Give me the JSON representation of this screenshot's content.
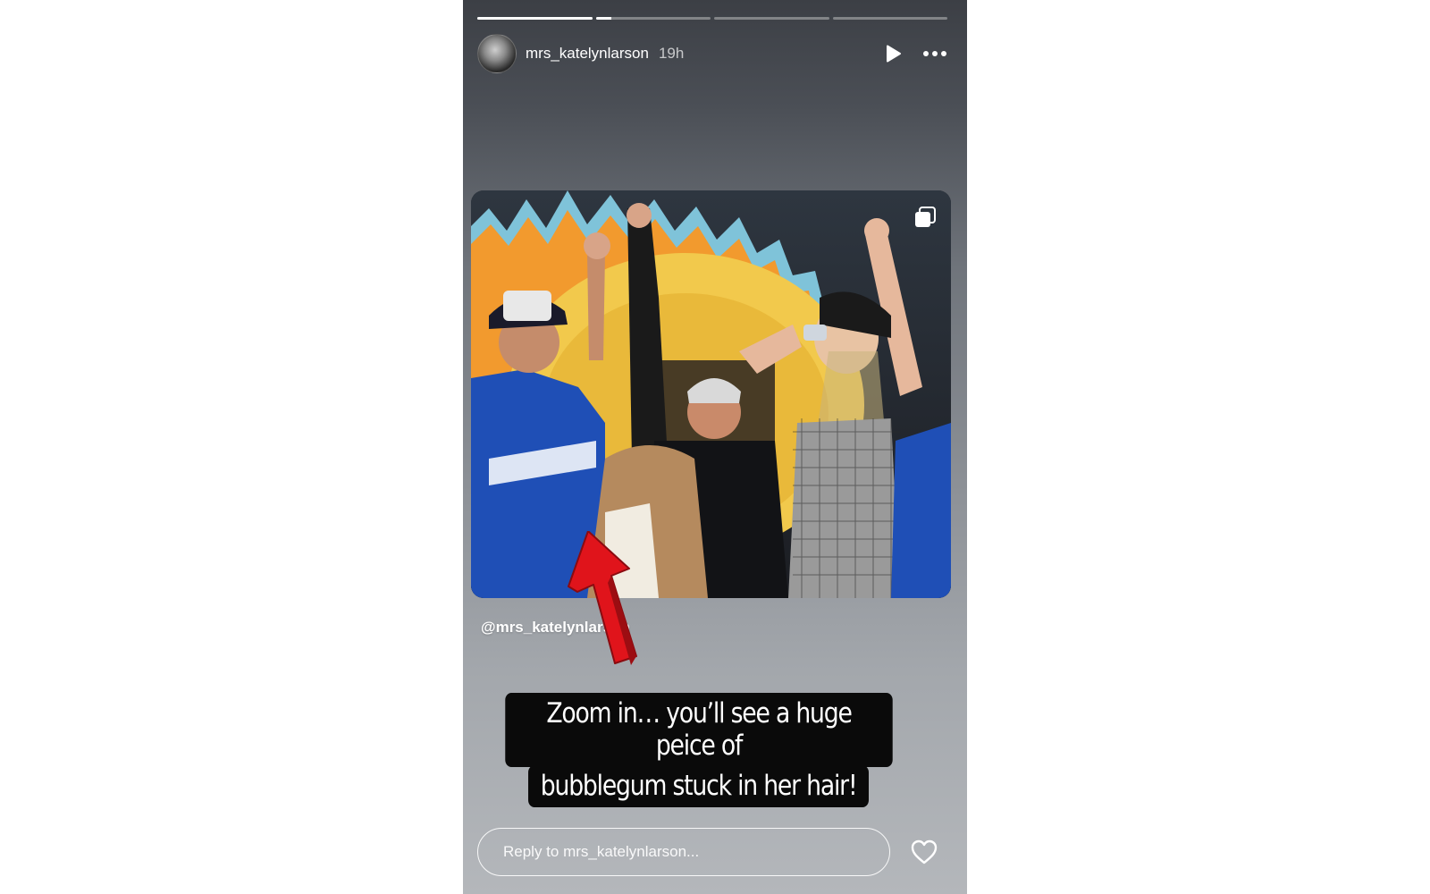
{
  "story": {
    "progress": [
      {
        "fill": 1.0
      },
      {
        "fill": 0.14
      },
      {
        "fill": 0.0
      },
      {
        "fill": 0.0
      }
    ]
  },
  "header": {
    "username": "mrs_katelynlarson",
    "time": "19h",
    "play_icon": "play-icon",
    "more_icon": "more-icon"
  },
  "post": {
    "image_icon": "carousel-multiple-icon"
  },
  "sticker": {
    "mention": "@mrs_katelynlarson",
    "arrow_icon": "red-arrow-icon"
  },
  "caption": {
    "line1": "Zoom in… you’ll see a huge peice of",
    "line2": "bubblegum stuck in her hair!"
  },
  "reply": {
    "placeholder": "Reply to mrs_katelynlarson...",
    "like_icon": "heart-icon"
  },
  "colors": {
    "caption_bg": "#0a0a0a",
    "arrow": "#e0141b",
    "accent_white": "#ffffff"
  }
}
